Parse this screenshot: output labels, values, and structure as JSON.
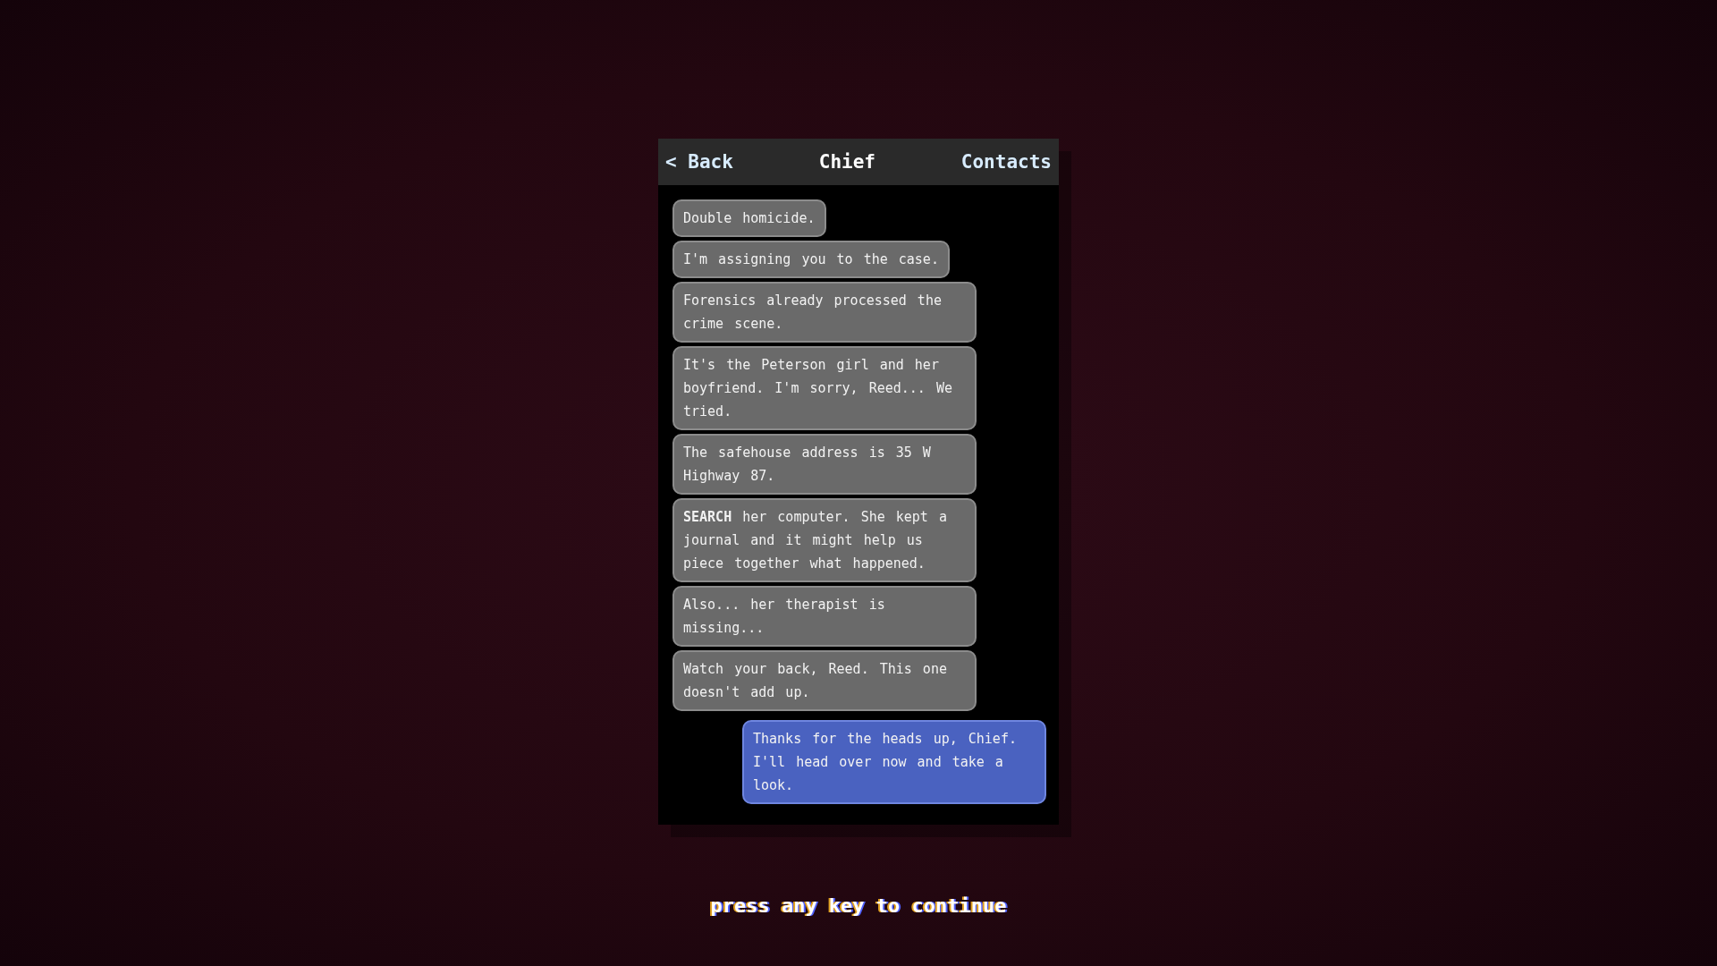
{
  "header": {
    "back": "< Back",
    "title": "Chief",
    "contacts": "Contacts"
  },
  "messages": [
    {
      "kind": "received",
      "text": "Double homicide."
    },
    {
      "kind": "received",
      "text": "I'm assigning you to the case."
    },
    {
      "kind": "received",
      "text": "Forensics already processed the crime scene."
    },
    {
      "kind": "received",
      "text": "It's the Peterson girl and her boyfriend. I'm sorry, Reed... We tried."
    },
    {
      "kind": "received",
      "text": "The safehouse address is 35 W Highway 87."
    },
    {
      "kind": "received",
      "text": "**SEARCH** her computer. She kept a journal and it might help us piece together what happened."
    },
    {
      "kind": "received",
      "text": "Also... her therapist is missing..."
    },
    {
      "kind": "received",
      "text": "Watch your back, Reed. This one doesn't add up."
    },
    {
      "kind": "sent",
      "text": "Thanks for the heads up, Chief. I'll head over now and take a look."
    }
  ],
  "prompt": "press any key to continue"
}
